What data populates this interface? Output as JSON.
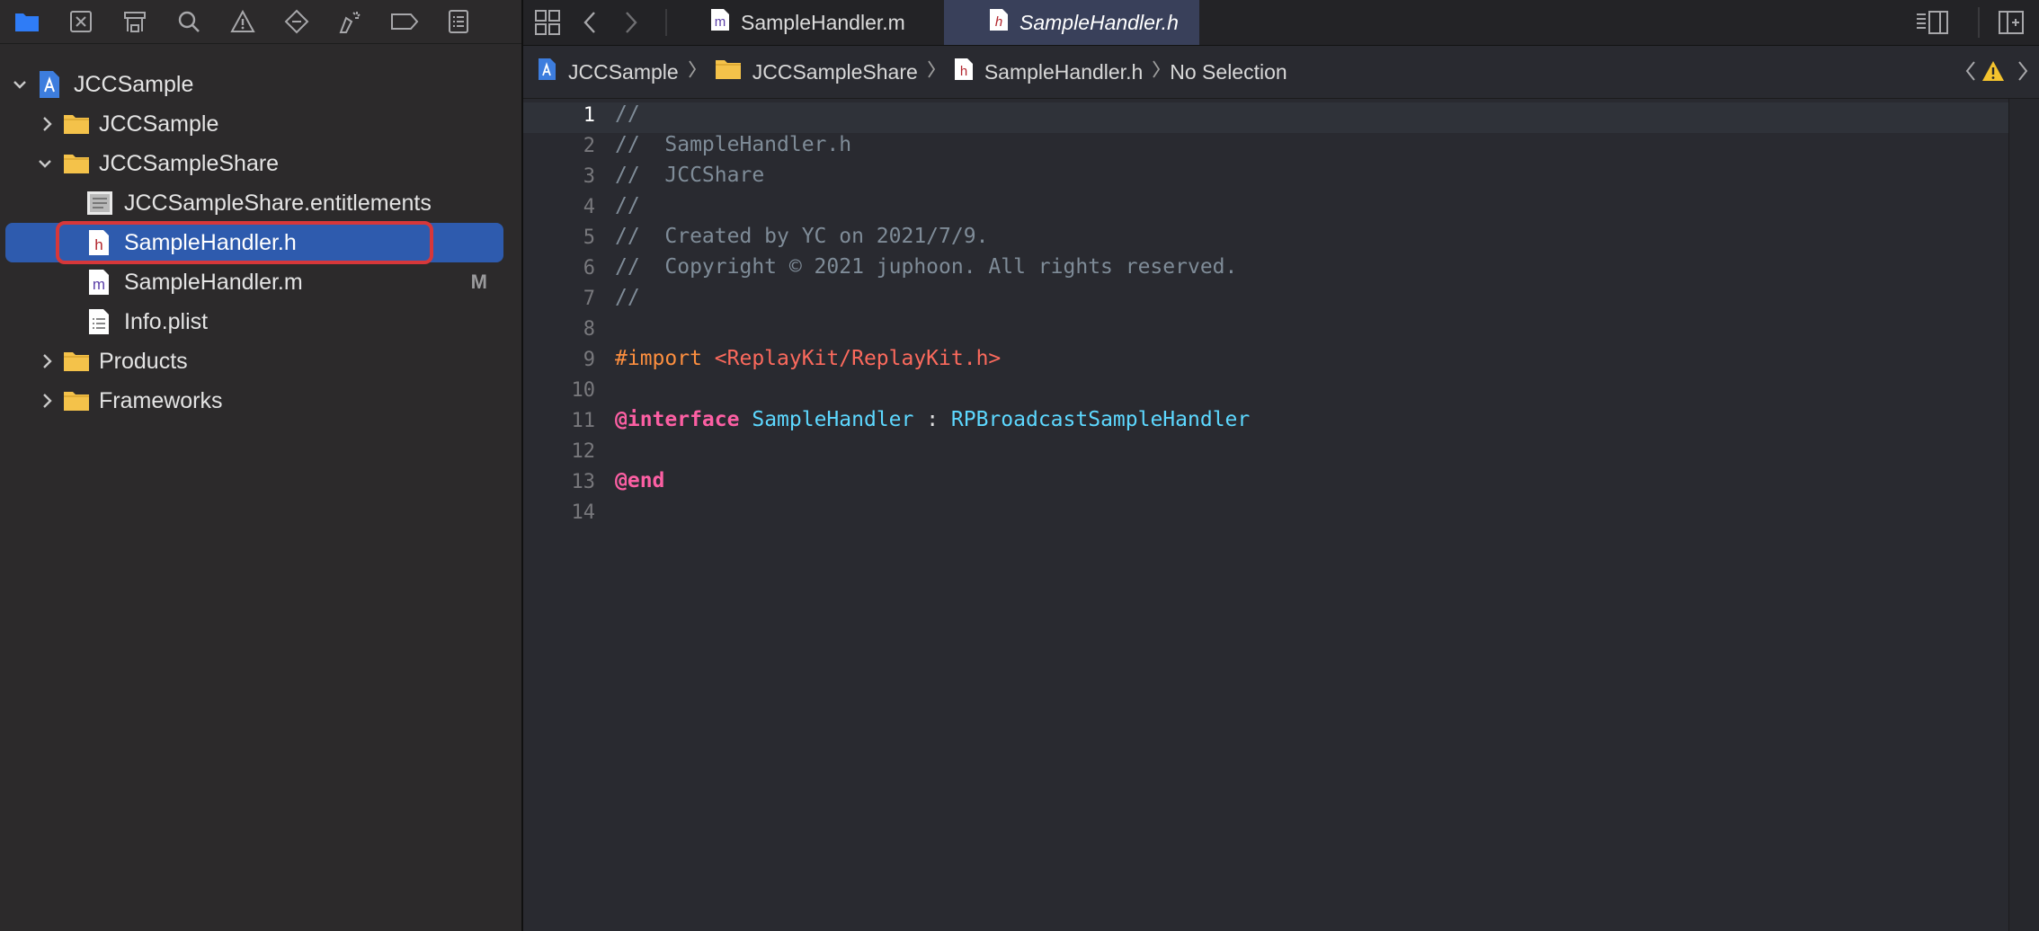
{
  "navigator": {
    "toolbar_icons": [
      "folder-icon",
      "source-control-icon",
      "symbol-icon",
      "search-icon",
      "warning-icon",
      "test-diamond-icon",
      "debug-icon",
      "breakpoint-icon",
      "report-icon"
    ],
    "tree": [
      {
        "label": "JCCSample",
        "kind": "project",
        "indent": 0,
        "expanded": true
      },
      {
        "label": "JCCSample",
        "kind": "folder",
        "indent": 1,
        "expanded": false
      },
      {
        "label": "JCCSampleShare",
        "kind": "folder",
        "indent": 1,
        "expanded": true
      },
      {
        "label": "JCCSampleShare.entitlements",
        "kind": "entitlements",
        "indent": 2
      },
      {
        "label": "SampleHandler.h",
        "kind": "header",
        "indent": 2,
        "selected": true
      },
      {
        "label": "SampleHandler.m",
        "kind": "impl",
        "indent": 2,
        "badge": "M"
      },
      {
        "label": "Info.plist",
        "kind": "plist",
        "indent": 2
      },
      {
        "label": "Products",
        "kind": "folder",
        "indent": 1,
        "expanded": false
      },
      {
        "label": "Frameworks",
        "kind": "folder",
        "indent": 1,
        "expanded": false
      }
    ]
  },
  "tabs": [
    {
      "label": "SampleHandler.m",
      "icon": "m"
    },
    {
      "label": "SampleHandler.h",
      "icon": "h",
      "active": true
    }
  ],
  "jumpbar": {
    "items": [
      "JCCSample",
      "JCCSampleShare",
      "SampleHandler.h",
      "No Selection"
    ]
  },
  "code": {
    "current_line": 1,
    "lines": [
      [
        [
          "cmt",
          "//"
        ]
      ],
      [
        [
          "cmt",
          "//  SampleHandler.h"
        ]
      ],
      [
        [
          "cmt",
          "//  JCCShare"
        ]
      ],
      [
        [
          "cmt",
          "//"
        ]
      ],
      [
        [
          "cmt",
          "//  Created by YC on 2021/7/9."
        ]
      ],
      [
        [
          "cmt",
          "//  Copyright © 2021 juphoon. All rights reserved."
        ]
      ],
      [
        [
          "cmt",
          "//"
        ]
      ],
      [],
      [
        [
          "pp",
          "#import "
        ],
        [
          "str",
          "<ReplayKit/ReplayKit.h>"
        ]
      ],
      [],
      [
        [
          "kw",
          "@interface"
        ],
        [
          "plain",
          " "
        ],
        [
          "typ",
          "SampleHandler"
        ],
        [
          "plain",
          " : "
        ],
        [
          "typ",
          "RPBroadcastSampleHandler"
        ]
      ],
      [],
      [
        [
          "kw",
          "@end"
        ]
      ],
      []
    ]
  }
}
